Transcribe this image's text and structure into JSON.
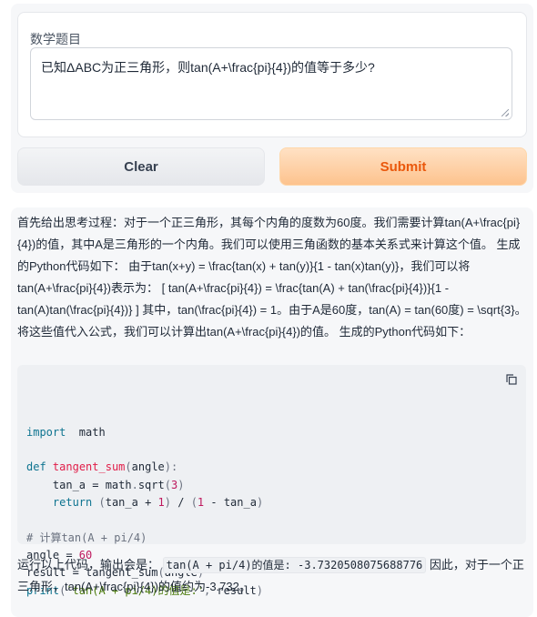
{
  "input": {
    "label": "数学题目",
    "value": "已知ΔABC为正三角形，则tan(A+\\frac{pi}{4})的值等于多少?",
    "clear_label": "Clear",
    "submit_label": "Submit"
  },
  "output": {
    "paragraph1": "首先给出思考过程：对于一个正三角形，其每个内角的度数为60度。我们需要计算tan(A+\\frac{pi}{4})的值，其中A是三角形的一个内角。我们可以使用三角函数的基本关系式来计算这个值。 生成的Python代码如下：  由于tan(x+y) = \\frac{tan(x) + tan(y)}{1 - tan(x)tan(y)}，我们可以将tan(A+\\frac{pi}{4})表示为：  [ tan(A+\\frac{pi}{4}) = \\frac{tan(A) + tan(\\frac{pi}{4})}{1 - tan(A)tan(\\frac{pi}{4})} ] 其中，tan(\\frac{pi}{4}) = 1。由于A是60度，tan(A) = tan(60度) = \\sqrt{3}。将这些值代入公式，我们可以计算出tan(A+\\frac{pi}{4})的值。 生成的Python代码如下：",
    "code_lines": [
      [
        [
          "kw",
          "import"
        ],
        [
          "",
          "  math"
        ]
      ],
      [],
      [
        [
          "kw",
          "def"
        ],
        [
          "",
          " "
        ],
        [
          "fn",
          "tangent_sum"
        ],
        [
          "pn",
          "("
        ],
        [
          "",
          "angle"
        ],
        [
          "pn",
          "):"
        ]
      ],
      [
        [
          "",
          "    tan_a = math"
        ],
        [
          "pn",
          "."
        ],
        [
          "",
          "sqrt"
        ],
        [
          "pn",
          "("
        ],
        [
          "num",
          "3"
        ],
        [
          "pn",
          ")"
        ]
      ],
      [
        [
          "",
          "    "
        ],
        [
          "kw",
          "return"
        ],
        [
          "",
          " "
        ],
        [
          "pn",
          "("
        ],
        [
          "",
          "tan_a + "
        ],
        [
          "num",
          "1"
        ],
        [
          "pn",
          ")"
        ],
        [
          "",
          " / "
        ],
        [
          "pn",
          "("
        ],
        [
          "num",
          "1"
        ],
        [
          "",
          " - tan_a"
        ],
        [
          "pn",
          ")"
        ]
      ],
      [],
      [
        [
          "cm",
          "# 计算tan(A + pi/4)"
        ]
      ],
      [
        [
          "",
          "angle = "
        ],
        [
          "num",
          "60"
        ]
      ],
      [
        [
          "",
          "result = tangent_sum"
        ],
        [
          "pn",
          "("
        ],
        [
          "",
          "angle"
        ],
        [
          "pn",
          ")"
        ]
      ],
      [
        [
          "kw",
          "print"
        ],
        [
          "pn",
          "("
        ],
        [
          "str",
          "'tan(A + pi/4)的值是:'"
        ],
        [
          "pn",
          ","
        ],
        [
          "",
          " result"
        ],
        [
          "pn",
          ")"
        ]
      ]
    ],
    "p2_prefix": "运行以上代码，输出会是： ",
    "p2_inline_code": "tan(A + pi/4)的值是: -3.7320508075688776",
    "p2_suffix": " 因此，对于一个正三角形，tan(A+\\frac{pi}{4})的值约为-3.732。"
  },
  "icons": {
    "copy": "copy-icon",
    "resize": "resize-grip-icon"
  }
}
